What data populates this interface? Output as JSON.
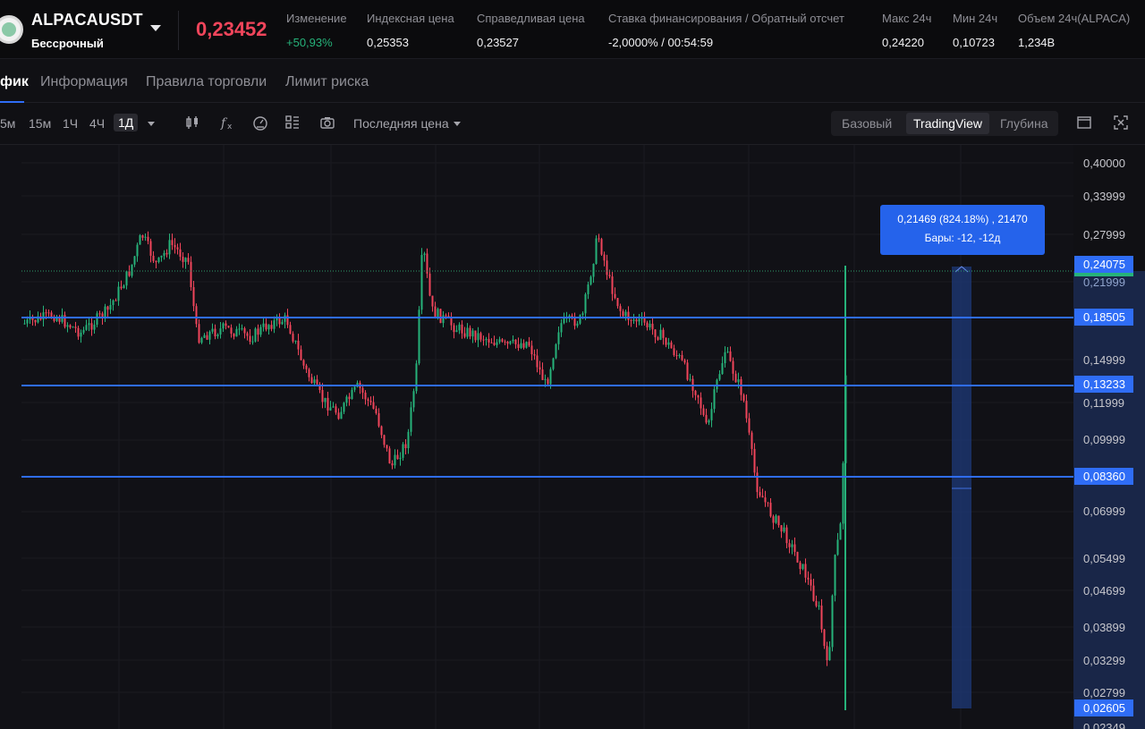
{
  "ticker": {
    "symbol": "ALPACAUSDT",
    "contract_type": "Бессрочный",
    "last_price": "0,23452",
    "stats": [
      {
        "label": "Изменение",
        "value": "+50,93%",
        "tone": "green"
      },
      {
        "label": "Индексная цена",
        "value": "0,25353",
        "tone": "normal"
      },
      {
        "label": "Справедливая цена",
        "value": "0,23527",
        "tone": "normal"
      },
      {
        "label": "Ставка финансирования / Обратный отсчет",
        "value": "-2,0000% / 00:54:59",
        "tone": "normal"
      },
      {
        "label": "Макс 24ч",
        "value": "0,24220",
        "tone": "normal"
      },
      {
        "label": "Мин 24ч",
        "value": "0,10723",
        "tone": "normal"
      },
      {
        "label": "Объем 24ч(ALPACA)",
        "value": "1,234B",
        "tone": "normal"
      }
    ]
  },
  "tabs": [
    "фик",
    "Информация",
    "Правила торговли",
    "Лимит риска"
  ],
  "toolbar": {
    "timeframes": [
      "5м",
      "15м",
      "1Ч",
      "4Ч",
      "1Д"
    ],
    "active_timeframe": "1Д",
    "price_type": "Последняя цена",
    "views": [
      "Базовый",
      "TradingView",
      "Глубина"
    ],
    "active_view": "TradingView",
    "tool_icons": [
      "candles-icon",
      "indicator-fx-icon",
      "gauge-icon",
      "layout-icon",
      "camera-icon",
      "window-icon",
      "fullscreen-icon"
    ]
  },
  "chart": {
    "price_axis": [
      "0,40000",
      "0,33999",
      "0,27999",
      "0,21999",
      "0,14999",
      "0,11999",
      "0,09999",
      "0,06999",
      "0,05499",
      "0,04699",
      "0,03899",
      "0,03299",
      "0,02799",
      "0,02349"
    ],
    "last_price_tag": "0,24075",
    "bottom_tag": "0,02605",
    "horizontal_levels": [
      "0,18505",
      "0,13233",
      "0,08360"
    ],
    "measure": {
      "line1": "0,21469 (824.18%) , 21470",
      "line2": "Бары: -12, -12д"
    },
    "colors": {
      "bull": "#26b27a",
      "bear": "#f0455b",
      "level_line": "#2f6df6",
      "measure": "#2563eb"
    }
  }
}
